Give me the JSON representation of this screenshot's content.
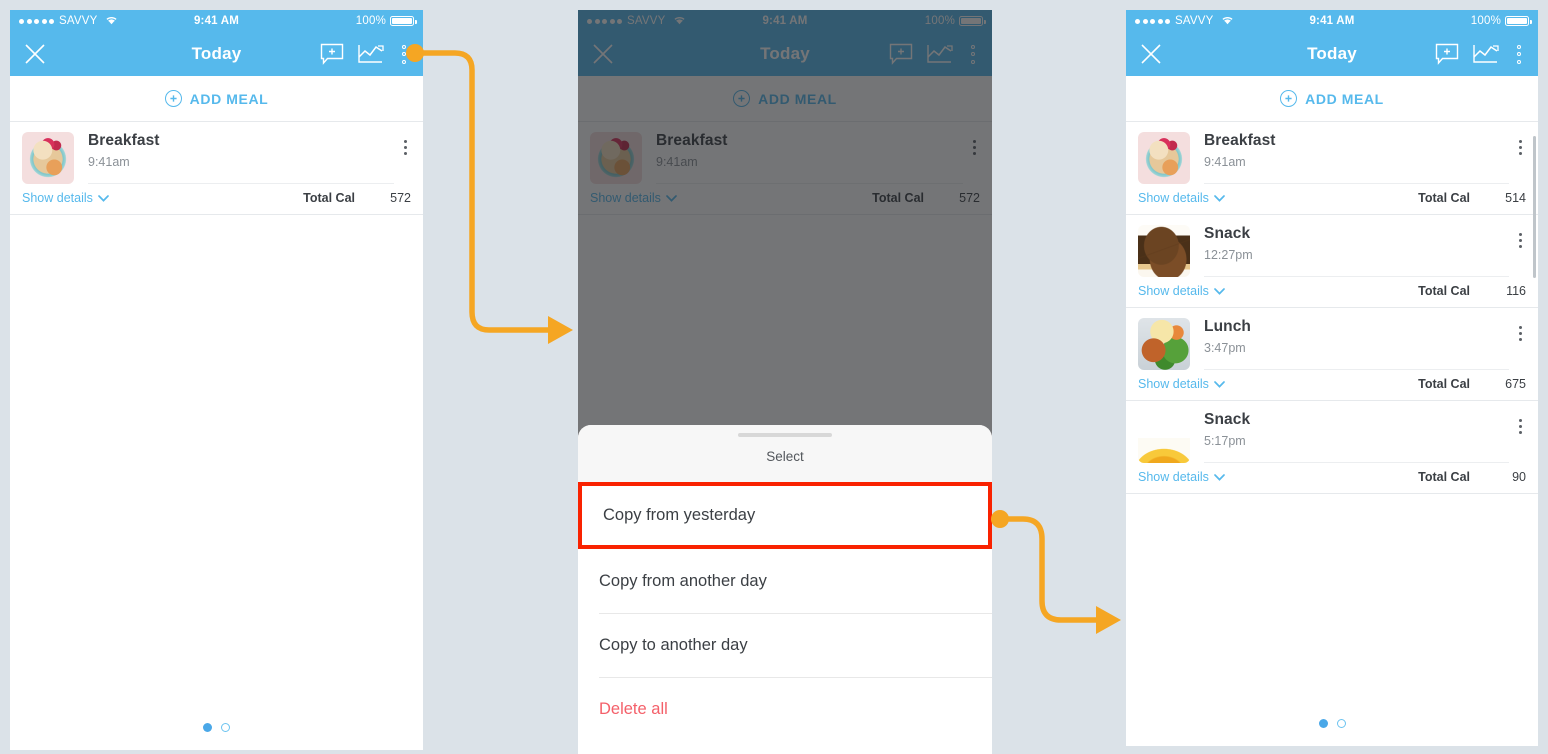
{
  "accent": "#56b9ec",
  "background": "#dbe2e8",
  "highlight_color": "#f92200",
  "connector_color": "#f5a623",
  "status_bar": {
    "carrier": "SAVVY",
    "time": "9:41 AM",
    "battery_pct": "100%",
    "wifi_icon": "wifi-icon",
    "signal_icon": "signal-dots-icon"
  },
  "nav": {
    "close_icon": "close-x-icon",
    "title": "Today",
    "comment_icon": "add-comment-icon",
    "chart_icon": "chart-trend-icon",
    "overflow_icon": "kebab-menu-icon"
  },
  "add_meal": {
    "label": "ADD MEAL",
    "icon": "plus-circle-icon"
  },
  "common": {
    "show_details": "Show details",
    "chevron_icon": "chevron-down-icon",
    "total_cal_label": "Total Cal",
    "row_menu_icon": "kebab-menu-icon"
  },
  "screens": [
    {
      "id": "screen-before",
      "meals": [
        {
          "name": "Breakfast",
          "time": "9:41am",
          "calories": "572",
          "thumb": "oatmeal-bowl-photo"
        }
      ],
      "page_dots": {
        "count": 2,
        "active_index": 0
      }
    },
    {
      "id": "screen-action-sheet",
      "meals": [
        {
          "name": "Breakfast",
          "time": "9:41am",
          "calories": "572",
          "thumb": "oatmeal-bowl-photo"
        }
      ],
      "sheet": {
        "title": "Select",
        "items": [
          {
            "label": "Copy from yesterday",
            "style": "highlighted"
          },
          {
            "label": "Copy from another day",
            "style": "normal"
          },
          {
            "label": "Copy to another day",
            "style": "normal"
          },
          {
            "label": "Delete all",
            "style": "danger"
          }
        ]
      }
    },
    {
      "id": "screen-after",
      "meals": [
        {
          "name": "Breakfast",
          "time": "9:41am",
          "calories": "514",
          "thumb": "oatmeal-bowl-photo"
        },
        {
          "name": "Snack",
          "time": "12:27pm",
          "calories": "116",
          "thumb": "brownies-photo"
        },
        {
          "name": "Lunch",
          "time": "3:47pm",
          "calories": "675",
          "thumb": "lunch-plate-photo"
        },
        {
          "name": "Snack",
          "time": "5:17pm",
          "calories": "90",
          "thumb": "banana-photo"
        }
      ],
      "page_dots": {
        "count": 2,
        "active_index": 0
      }
    }
  ],
  "connectors": [
    {
      "name": "connector-overflow-to-sheet",
      "from": "kebab-menu-icon",
      "to": "screen-action-sheet"
    },
    {
      "name": "connector-copy-yesterday-to-result",
      "from": "copy-from-yesterday-item",
      "to": "screen-after"
    }
  ]
}
